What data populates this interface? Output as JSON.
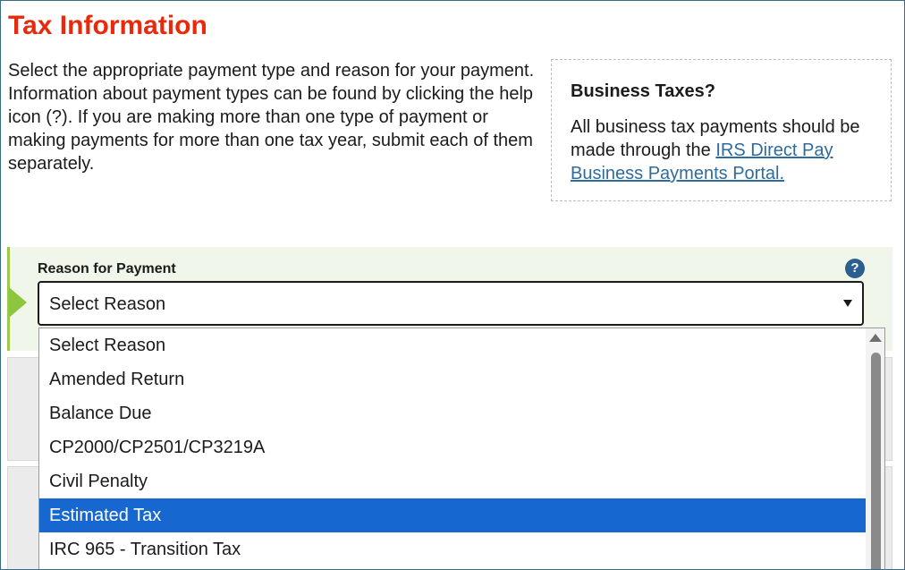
{
  "page": {
    "title": "Tax Information",
    "intro": "Select the appropriate payment type and reason for your payment. Information about payment types can be found by clicking the help icon (?). If you are making more than one type of payment or making payments for more than one tax year, submit each of them separately."
  },
  "business_box": {
    "title": "Business Taxes?",
    "text_before_link": "All business tax payments should be made through the ",
    "link_text": "IRS Direct Pay Business Payments Portal."
  },
  "reason_for_payment": {
    "label": "Reason for Payment",
    "help_icon": "?",
    "selected_value": "Select Reason",
    "options": [
      "Select Reason",
      "Amended Return",
      "Balance Due",
      "CP2000/CP2501/CP3219A",
      "Civil Penalty",
      "Estimated Tax",
      "IRC 965 - Transition Tax"
    ],
    "highlighted_option": "Estimated Tax"
  },
  "colors": {
    "title": "#e8290b",
    "link": "#2f6b9d",
    "highlight": "#1668d0",
    "step_accent": "#8cc63f",
    "section_bg": "#f1f6ea",
    "help_icon_bg": "#2b5f8f"
  },
  "icons": {
    "step": "step-arrow-icon",
    "help": "help-icon",
    "dropdown": "chevron-down-icon",
    "scroll_up": "scroll-up-icon"
  }
}
